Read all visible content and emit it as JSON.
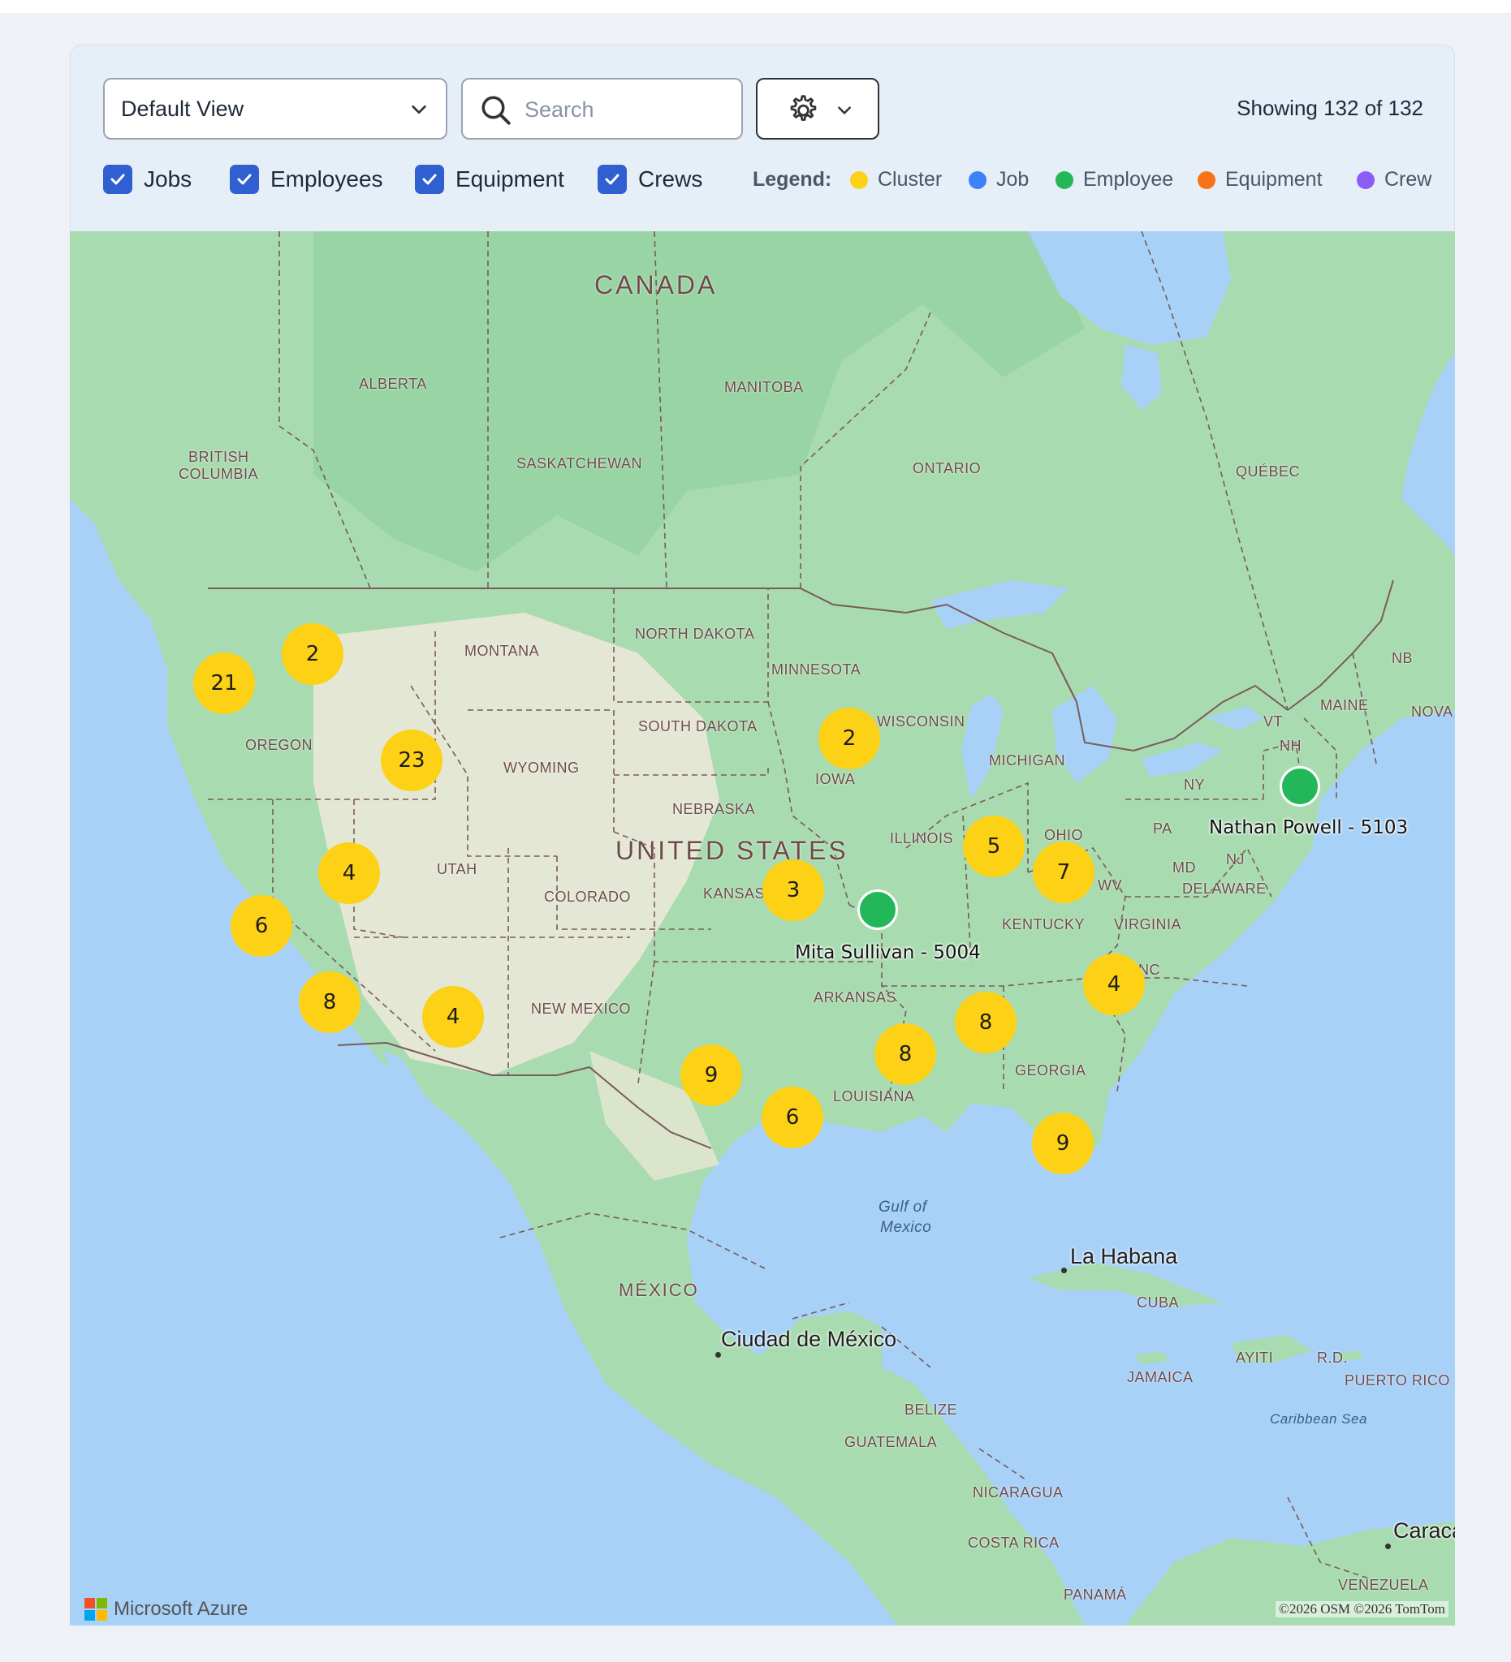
{
  "toolbar": {
    "view_select": "Default View",
    "search_placeholder": "Search",
    "showing": "Showing 132 of 132"
  },
  "filters": [
    {
      "label": "Jobs",
      "checked": true
    },
    {
      "label": "Employees",
      "checked": true
    },
    {
      "label": "Equipment",
      "checked": true
    },
    {
      "label": "Crews",
      "checked": true
    }
  ],
  "legend": {
    "title": "Legend:",
    "items": [
      {
        "label": "Cluster",
        "color": "#fcd116"
      },
      {
        "label": "Job",
        "color": "#3b82f6"
      },
      {
        "label": "Employee",
        "color": "#22b859"
      },
      {
        "label": "Equipment",
        "color": "#f97316"
      },
      {
        "label": "Crew",
        "color": "#8b5cf6"
      }
    ]
  },
  "map": {
    "clusters": [
      "21",
      "2",
      "23",
      "4",
      "6",
      "8",
      "4",
      "2",
      "3",
      "5",
      "7",
      "4",
      "8",
      "8",
      "9",
      "6",
      "9"
    ],
    "employees": [
      "Mita Sullivan - 5004",
      "Nathan Powell - 5103"
    ],
    "country_labels": [
      "CANADA",
      "UNITED STATES",
      "MÉXICO"
    ],
    "region_labels": [
      "ALBERTA",
      "BRITISH",
      "COLUMBIA",
      "SASKATCHEWAN",
      "MANITOBA",
      "ONTARIO",
      "QUÉBEC",
      "MONTANA",
      "NORTH DAKOTA",
      "MINNESOTA",
      "SOUTH DAKOTA",
      "WISCONSIN",
      "MICHIGAN",
      "OREGON",
      "WYOMING",
      "IOWA",
      "NEBRASKA",
      "ILLINOIS",
      "OHIO",
      "UTAH",
      "COLORADO",
      "KANSAS",
      "KENTUCKY",
      "VIRGINIA",
      "ARKANSAS",
      "NEW MEXICO",
      "GEORGIA",
      "LOUISIANA",
      "NY",
      "PA",
      "NJ",
      "MD",
      "DELAWARE",
      "WV",
      "NC",
      "VT",
      "NH",
      "MAINE",
      "NB",
      "NOVA",
      "CUBA",
      "JAMAICA",
      "AYITI",
      "R.D.",
      "PUERTO RICO",
      "BELIZE",
      "GUATEMALA",
      "NICARAGUA",
      "COSTA RICA",
      "PANAMÁ",
      "VENEZUELA"
    ],
    "city_labels": [
      "La Habana",
      "Ciudad de México",
      "Caraca"
    ],
    "water_labels": [
      "Gulf of",
      "Mexico",
      "Caribbean Sea"
    ],
    "brand": "Microsoft Azure",
    "attribution": "©2026 OSM ©2026 TomTom"
  }
}
